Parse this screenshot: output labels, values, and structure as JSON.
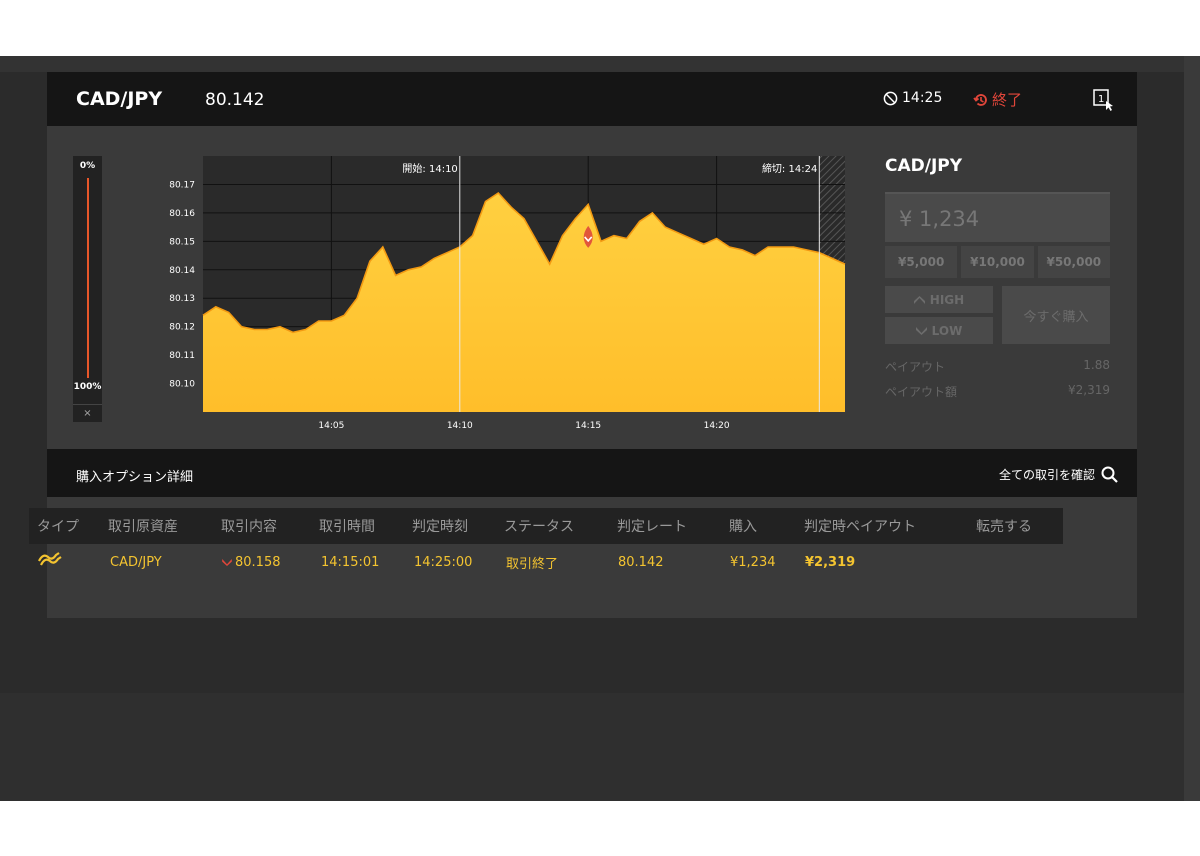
{
  "header": {
    "pair": "CAD/JPY",
    "rate": "80.142",
    "time": "14:25",
    "status": "終了"
  },
  "progress": {
    "top_label": "0%",
    "bottom_label": "100%",
    "close": "×"
  },
  "chart_data": {
    "type": "area",
    "title": "",
    "y_ticks": [
      "80.10",
      "80.11",
      "80.12",
      "80.13",
      "80.14",
      "80.15",
      "80.16",
      "80.17"
    ],
    "x_ticks": [
      "14:05",
      "14:10",
      "14:15",
      "14:20"
    ],
    "ylim": [
      80.09,
      80.18
    ],
    "xlim": [
      "14:00",
      "14:25"
    ],
    "start_label": "開始: 14:10",
    "end_label": "締切: 14:24",
    "entry": {
      "x": "14:15",
      "y": 80.1505
    },
    "x": [
      "14:00",
      "14:00:30",
      "14:01",
      "14:01:30",
      "14:02",
      "14:02:30",
      "14:03",
      "14:03:30",
      "14:04",
      "14:04:30",
      "14:05",
      "14:05:30",
      "14:06",
      "14:06:30",
      "14:07",
      "14:07:30",
      "14:08",
      "14:08:30",
      "14:09",
      "14:09:30",
      "14:10",
      "14:10:30",
      "14:11",
      "14:11:30",
      "14:12",
      "14:12:30",
      "14:13",
      "14:13:30",
      "14:14",
      "14:14:30",
      "14:15",
      "14:15:30",
      "14:16",
      "14:16:30",
      "14:17",
      "14:17:30",
      "14:18",
      "14:18:30",
      "14:19",
      "14:19:30",
      "14:20",
      "14:20:30",
      "14:21",
      "14:21:30",
      "14:22",
      "14:22:30",
      "14:23",
      "14:23:30",
      "14:24",
      "14:24:30",
      "14:25"
    ],
    "values": [
      80.124,
      80.127,
      80.125,
      80.12,
      80.119,
      80.119,
      80.12,
      80.118,
      80.119,
      80.122,
      80.122,
      80.124,
      80.13,
      80.143,
      80.148,
      80.138,
      80.14,
      80.141,
      80.144,
      80.146,
      80.148,
      80.152,
      80.164,
      80.167,
      80.162,
      80.158,
      80.15,
      80.142,
      80.152,
      80.158,
      80.163,
      80.15,
      80.152,
      80.151,
      80.157,
      80.16,
      80.155,
      80.153,
      80.151,
      80.149,
      80.151,
      80.148,
      80.147,
      80.145,
      80.148,
      80.148,
      80.148,
      80.147,
      80.146,
      80.144,
      80.142
    ]
  },
  "order": {
    "title": "CAD/JPY",
    "amount": "¥ 1,234",
    "presets": [
      "¥5,000",
      "¥10,000",
      "¥50,000"
    ],
    "high": "HIGH",
    "low": "LOW",
    "buy_now": "今すぐ購入",
    "payout_label": "ペイアウト",
    "payout_value": "1.88",
    "payout_amount_label": "ペイアウト額",
    "payout_amount_value": "¥2,319"
  },
  "details": {
    "title": "購入オプション詳細",
    "confirm_all": "全ての取引を確認"
  },
  "table": {
    "headers": [
      "タイプ",
      "取引原資産",
      "取引内容",
      "取引時間",
      "判定時刻",
      "ステータス",
      "判定レート",
      "購入",
      "判定時ペイアウト",
      "転売する"
    ],
    "row": {
      "asset": "CAD/JPY",
      "content": "80.158",
      "trade_time": "14:15:01",
      "judge_time": "14:25:00",
      "status": "取引終了",
      "judge_rate": "80.142",
      "purchase": "¥1,234",
      "payout": "¥2,319"
    }
  },
  "colors": {
    "accent": "#f4c430",
    "chart_fill": "#ffc531",
    "red": "#e2463a"
  }
}
